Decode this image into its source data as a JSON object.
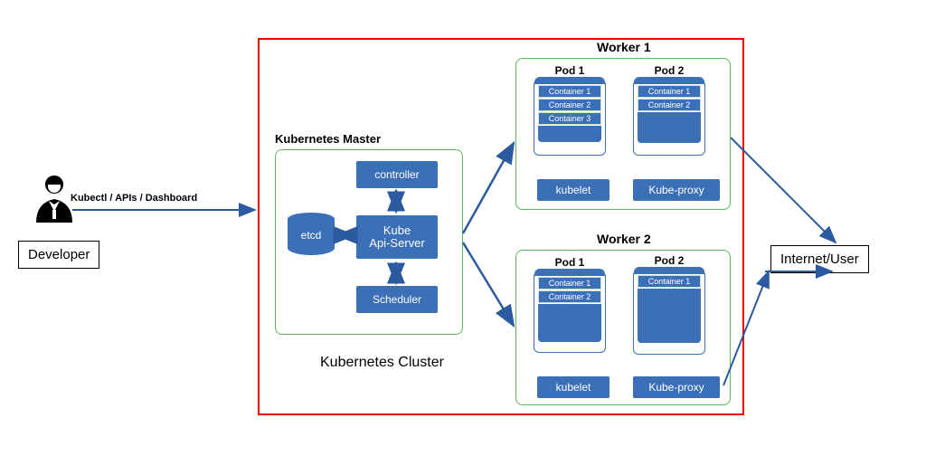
{
  "developer": "Developer",
  "kubectl_label": "Kubectl / APIs / Dashboard",
  "master_label": "Kubernetes Master",
  "cluster_label": "Kubernetes Cluster",
  "internet": "Internet/User",
  "master": {
    "controller": "controller",
    "api_server_l1": "Kube",
    "api_server_l2": "Api-Server",
    "scheduler": "Scheduler",
    "etcd": "etcd"
  },
  "workers": [
    {
      "title": "Worker 1",
      "pods": [
        {
          "title": "Pod 1",
          "containers": [
            "Container 1",
            "Container 2",
            "Container 3"
          ]
        },
        {
          "title": "Pod 2",
          "containers": [
            "Container 1",
            "Container 2"
          ]
        }
      ],
      "kubelet": "kubelet",
      "kubeproxy": "Kube-proxy"
    },
    {
      "title": "Worker 2",
      "pods": [
        {
          "title": "Pod 1",
          "containers": [
            "Container 1",
            "Container 2"
          ]
        },
        {
          "title": "Pod 2",
          "containers": [
            "Container 1"
          ]
        }
      ],
      "kubelet": "kubelet",
      "kubeproxy": "Kube-proxy"
    }
  ]
}
